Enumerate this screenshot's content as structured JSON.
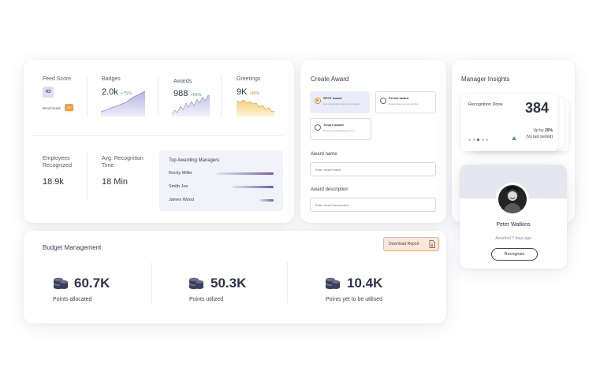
{
  "stats": {
    "feed_score_label": "Feed Score",
    "feed_score_value": "43",
    "benchmark_label": "Benchmark",
    "benchmark_badge": "55",
    "badges_label": "Badges",
    "badges_value": "2.0k",
    "badges_delta": "+75%",
    "awards_label": "Awards",
    "awards_value": "988",
    "awards_delta": "+65%",
    "greetings_label": "Greetings",
    "greetings_value": "9K",
    "greetings_delta": "-45%",
    "employees_label": "Employees Recognized",
    "employees_value": "18.9k",
    "avg_time_label": "Avg. Recognition Time",
    "avg_time_value": "18 Min",
    "top_managers_title": "Top Awarding Managers",
    "managers": [
      {
        "name": "Rocky Miller",
        "share": 0.72
      },
      {
        "name": "Smith Joe",
        "share": 0.52
      },
      {
        "name": "James Wood",
        "share": 0.18
      }
    ],
    "colors": {
      "positive": "#3fb26a",
      "negative": "#e8852e"
    }
  },
  "create_award": {
    "title": "Create Award",
    "options": [
      {
        "title": "SPOT award",
        "sub": "Get instant approval on your award",
        "selected": true
      },
      {
        "title": "Period award",
        "sub": "Reward team across all time",
        "selected": false
      },
      {
        "title": "Tenure award",
        "sub": "Honor by celebrating 1 yr, 5 yr",
        "selected": false
      }
    ],
    "name_label": "Award name",
    "name_placeholder": "Enter award name",
    "desc_label": "Award description",
    "desc_placeholder": "Enter award description"
  },
  "insights": {
    "title": "Manager Insights",
    "recognition_label": "Recognition Done",
    "recognition_value": "384",
    "up_by_prefix": "Up by ",
    "up_by_value": "20%",
    "up_by_period": "(Vs last period)"
  },
  "profile": {
    "name": "Peter Watkins",
    "meta": "Awarded 7 days ago",
    "button": "Recognize"
  },
  "budget": {
    "title": "Budget Management",
    "download_label": "Download Report",
    "items": [
      {
        "value": "60.7K",
        "label": "Points allocated"
      },
      {
        "value": "50.3K",
        "label": "Points utilized"
      },
      {
        "value": "10.4K",
        "label": "Points yet to be utilised"
      }
    ],
    "accent": "#3b3f5c"
  }
}
